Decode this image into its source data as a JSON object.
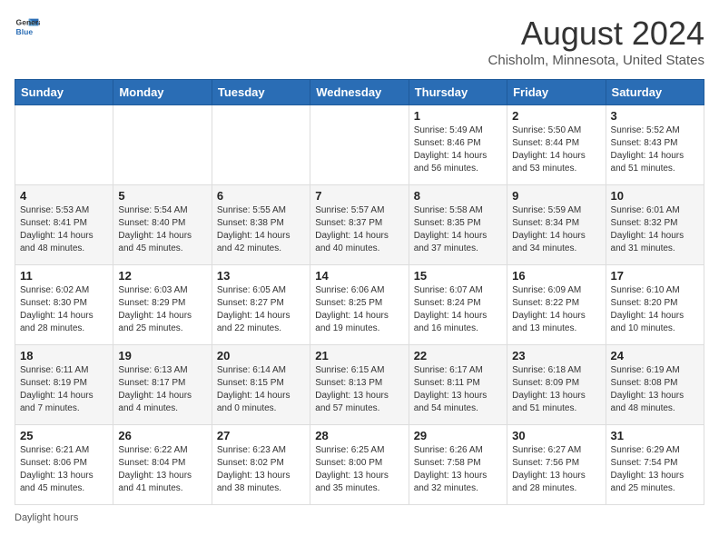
{
  "header": {
    "logo_general": "General",
    "logo_blue": "Blue",
    "main_title": "August 2024",
    "subtitle": "Chisholm, Minnesota, United States"
  },
  "calendar": {
    "days_of_week": [
      "Sunday",
      "Monday",
      "Tuesday",
      "Wednesday",
      "Thursday",
      "Friday",
      "Saturday"
    ],
    "weeks": [
      [
        {
          "day": "",
          "info": ""
        },
        {
          "day": "",
          "info": ""
        },
        {
          "day": "",
          "info": ""
        },
        {
          "day": "",
          "info": ""
        },
        {
          "day": "1",
          "info": "Sunrise: 5:49 AM\nSunset: 8:46 PM\nDaylight: 14 hours and 56 minutes."
        },
        {
          "day": "2",
          "info": "Sunrise: 5:50 AM\nSunset: 8:44 PM\nDaylight: 14 hours and 53 minutes."
        },
        {
          "day": "3",
          "info": "Sunrise: 5:52 AM\nSunset: 8:43 PM\nDaylight: 14 hours and 51 minutes."
        }
      ],
      [
        {
          "day": "4",
          "info": "Sunrise: 5:53 AM\nSunset: 8:41 PM\nDaylight: 14 hours and 48 minutes."
        },
        {
          "day": "5",
          "info": "Sunrise: 5:54 AM\nSunset: 8:40 PM\nDaylight: 14 hours and 45 minutes."
        },
        {
          "day": "6",
          "info": "Sunrise: 5:55 AM\nSunset: 8:38 PM\nDaylight: 14 hours and 42 minutes."
        },
        {
          "day": "7",
          "info": "Sunrise: 5:57 AM\nSunset: 8:37 PM\nDaylight: 14 hours and 40 minutes."
        },
        {
          "day": "8",
          "info": "Sunrise: 5:58 AM\nSunset: 8:35 PM\nDaylight: 14 hours and 37 minutes."
        },
        {
          "day": "9",
          "info": "Sunrise: 5:59 AM\nSunset: 8:34 PM\nDaylight: 14 hours and 34 minutes."
        },
        {
          "day": "10",
          "info": "Sunrise: 6:01 AM\nSunset: 8:32 PM\nDaylight: 14 hours and 31 minutes."
        }
      ],
      [
        {
          "day": "11",
          "info": "Sunrise: 6:02 AM\nSunset: 8:30 PM\nDaylight: 14 hours and 28 minutes."
        },
        {
          "day": "12",
          "info": "Sunrise: 6:03 AM\nSunset: 8:29 PM\nDaylight: 14 hours and 25 minutes."
        },
        {
          "day": "13",
          "info": "Sunrise: 6:05 AM\nSunset: 8:27 PM\nDaylight: 14 hours and 22 minutes."
        },
        {
          "day": "14",
          "info": "Sunrise: 6:06 AM\nSunset: 8:25 PM\nDaylight: 14 hours and 19 minutes."
        },
        {
          "day": "15",
          "info": "Sunrise: 6:07 AM\nSunset: 8:24 PM\nDaylight: 14 hours and 16 minutes."
        },
        {
          "day": "16",
          "info": "Sunrise: 6:09 AM\nSunset: 8:22 PM\nDaylight: 14 hours and 13 minutes."
        },
        {
          "day": "17",
          "info": "Sunrise: 6:10 AM\nSunset: 8:20 PM\nDaylight: 14 hours and 10 minutes."
        }
      ],
      [
        {
          "day": "18",
          "info": "Sunrise: 6:11 AM\nSunset: 8:19 PM\nDaylight: 14 hours and 7 minutes."
        },
        {
          "day": "19",
          "info": "Sunrise: 6:13 AM\nSunset: 8:17 PM\nDaylight: 14 hours and 4 minutes."
        },
        {
          "day": "20",
          "info": "Sunrise: 6:14 AM\nSunset: 8:15 PM\nDaylight: 14 hours and 0 minutes."
        },
        {
          "day": "21",
          "info": "Sunrise: 6:15 AM\nSunset: 8:13 PM\nDaylight: 13 hours and 57 minutes."
        },
        {
          "day": "22",
          "info": "Sunrise: 6:17 AM\nSunset: 8:11 PM\nDaylight: 13 hours and 54 minutes."
        },
        {
          "day": "23",
          "info": "Sunrise: 6:18 AM\nSunset: 8:09 PM\nDaylight: 13 hours and 51 minutes."
        },
        {
          "day": "24",
          "info": "Sunrise: 6:19 AM\nSunset: 8:08 PM\nDaylight: 13 hours and 48 minutes."
        }
      ],
      [
        {
          "day": "25",
          "info": "Sunrise: 6:21 AM\nSunset: 8:06 PM\nDaylight: 13 hours and 45 minutes."
        },
        {
          "day": "26",
          "info": "Sunrise: 6:22 AM\nSunset: 8:04 PM\nDaylight: 13 hours and 41 minutes."
        },
        {
          "day": "27",
          "info": "Sunrise: 6:23 AM\nSunset: 8:02 PM\nDaylight: 13 hours and 38 minutes."
        },
        {
          "day": "28",
          "info": "Sunrise: 6:25 AM\nSunset: 8:00 PM\nDaylight: 13 hours and 35 minutes."
        },
        {
          "day": "29",
          "info": "Sunrise: 6:26 AM\nSunset: 7:58 PM\nDaylight: 13 hours and 32 minutes."
        },
        {
          "day": "30",
          "info": "Sunrise: 6:27 AM\nSunset: 7:56 PM\nDaylight: 13 hours and 28 minutes."
        },
        {
          "day": "31",
          "info": "Sunrise: 6:29 AM\nSunset: 7:54 PM\nDaylight: 13 hours and 25 minutes."
        }
      ]
    ]
  },
  "footer": {
    "note": "Daylight hours"
  }
}
